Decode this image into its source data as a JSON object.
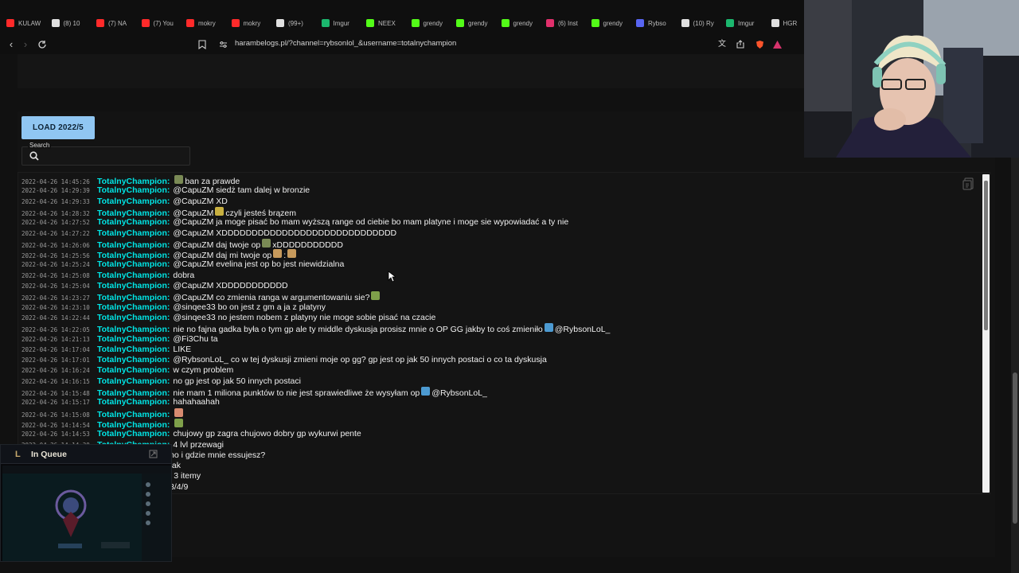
{
  "browser": {
    "tabs": [
      {
        "label": "KULAW",
        "icon": "youtube-icon",
        "color": "#ff2a2a"
      },
      {
        "label": "(8) 10",
        "icon": "x-icon",
        "color": "#e0e0e0"
      },
      {
        "label": "(7) NA",
        "icon": "youtube-icon",
        "color": "#ff2a2a"
      },
      {
        "label": "(7) You",
        "icon": "youtube-icon",
        "color": "#ff2a2a"
      },
      {
        "label": "mokry",
        "icon": "youtube-icon",
        "color": "#ff2a2a"
      },
      {
        "label": "mokry",
        "icon": "youtube-icon",
        "color": "#ff2a2a"
      },
      {
        "label": "(99+)",
        "icon": "tiktok-icon",
        "color": "#e0e0e0"
      },
      {
        "label": "Imgur",
        "icon": "imgur-icon",
        "color": "#1bb76e"
      },
      {
        "label": "NEEX",
        "icon": "kick-icon",
        "color": "#53fc18"
      },
      {
        "label": "grendy",
        "icon": "kick-icon",
        "color": "#53fc18"
      },
      {
        "label": "grendy",
        "icon": "kick-icon",
        "color": "#53fc18"
      },
      {
        "label": "grendy",
        "icon": "kick-icon",
        "color": "#53fc18"
      },
      {
        "label": "(6) Inst",
        "icon": "instagram-icon",
        "color": "#e1306c"
      },
      {
        "label": "grendy",
        "icon": "kick-icon",
        "color": "#53fc18"
      },
      {
        "label": "Rybso",
        "icon": "discord-icon",
        "color": "#5865f2"
      },
      {
        "label": "(10) Ry",
        "icon": "x-icon",
        "color": "#e0e0e0"
      },
      {
        "label": "Imgur",
        "icon": "imgur-icon",
        "color": "#1bb76e"
      },
      {
        "label": "HGR",
        "icon": "x-icon",
        "color": "#e0e0e0"
      }
    ],
    "url": "harambelogs.pl/?channel=rybsonlol_&username=totalnychampion"
  },
  "page": {
    "load_button": "LOAD 2022/5",
    "search_label": "Search",
    "search_value": ""
  },
  "log": [
    {
      "ts": "2022-04-26 14:45:26",
      "user": "TotalnyChampion:",
      "msg": "ban za prawde",
      "emote_before": true
    },
    {
      "ts": "2022-04-26 14:29:39",
      "user": "TotalnyChampion:",
      "msg": "@CapuZM siedż tam dalej w bronzie"
    },
    {
      "ts": "2022-04-26 14:29:33",
      "user": "TotalnyChampion:",
      "msg": "@CapuZM XD"
    },
    {
      "ts": "2022-04-26 14:28:32",
      "user": "TotalnyChampion:",
      "msg": "@CapuZM",
      "msg_after": "czyli jesteś brązem",
      "emote_mid": true
    },
    {
      "ts": "2022-04-26 14:27:52",
      "user": "TotalnyChampion:",
      "msg": "@CapuZM ja moge pisać bo mam wyższą range od ciebie bo mam platyne i moge sie wypowiadać a ty nie"
    },
    {
      "ts": "2022-04-26 14:27:22",
      "user": "TotalnyChampion:",
      "msg": "@CapuZM XDDDDDDDDDDDDDDDDDDDDDDDDDDDDD"
    },
    {
      "ts": "2022-04-26 14:26:06",
      "user": "TotalnyChampion:",
      "msg": "@CapuZM daj twoje op",
      "msg_after": "xDDDDDDDDDDD",
      "emote_mid": true
    },
    {
      "ts": "2022-04-26 14:25:56",
      "user": "TotalnyChampion:",
      "msg": "@CapuZM daj mi twoje op",
      "msg_after": ":",
      "emote_mid": true,
      "emote_end": true
    },
    {
      "ts": "2022-04-26 14:25:24",
      "user": "TotalnyChampion:",
      "msg": "@CapuZM evelina jest op bo jest niewidzialna"
    },
    {
      "ts": "2022-04-26 14:25:08",
      "user": "TotalnyChampion:",
      "msg": "dobra"
    },
    {
      "ts": "2022-04-26 14:25:04",
      "user": "TotalnyChampion:",
      "msg": "@CapuZM XDDDDDDDDDDD"
    },
    {
      "ts": "2022-04-26 14:23:27",
      "user": "TotalnyChampion:",
      "msg": "@CapuZM co zmienia ranga w argumentowaniu sie?",
      "emote_end": true
    },
    {
      "ts": "2022-04-26 14:23:10",
      "user": "TotalnyChampion:",
      "msg": "@sinqee33 bo on jest z gm a ja z platyny"
    },
    {
      "ts": "2022-04-26 14:22:44",
      "user": "TotalnyChampion:",
      "msg": "@sinqee33 no jestem nobem z platyny nie moge sobie pisać na czacie"
    },
    {
      "ts": "2022-04-26 14:22:05",
      "user": "TotalnyChampion:",
      "msg": "nie no fajna gadka była o tym gp ale ty middle dyskusja prosisz mnie o OP GG jakby to coś zmieniło",
      "msg_after": "@RybsonLoL_",
      "emote_mid": true
    },
    {
      "ts": "2022-04-26 14:21:13",
      "user": "TotalnyChampion:",
      "msg": "@Fi3Chu ta"
    },
    {
      "ts": "2022-04-26 14:17:04",
      "user": "TotalnyChampion:",
      "msg": "LIKE"
    },
    {
      "ts": "2022-04-26 14:17:01",
      "user": "TotalnyChampion:",
      "msg": "@RybsonLoL_ co w tej dyskusji zmieni moje op gg? gp jest op jak 50 innych postaci o co ta dyskusja"
    },
    {
      "ts": "2022-04-26 14:16:24",
      "user": "TotalnyChampion:",
      "msg": "w czym problem"
    },
    {
      "ts": "2022-04-26 14:16:15",
      "user": "TotalnyChampion:",
      "msg": "no gp jest op jak 50 innych postaci"
    },
    {
      "ts": "2022-04-26 14:15:48",
      "user": "TotalnyChampion:",
      "msg": "nie mam 1 miliona punktów to nie jest sprawiedliwe że wysyłam op",
      "msg_after": "@RybsonLoL_",
      "emote_mid": true
    },
    {
      "ts": "2022-04-26 14:15:17",
      "user": "TotalnyChampion:",
      "msg": "hahahaahah"
    },
    {
      "ts": "2022-04-26 14:15:08",
      "user": "TotalnyChampion:",
      "msg": "",
      "emote_end": true
    },
    {
      "ts": "2022-04-26 14:14:54",
      "user": "TotalnyChampion:",
      "msg": "",
      "emote_end": true
    },
    {
      "ts": "2022-04-26 14:14:53",
      "user": "TotalnyChampion:",
      "msg": "chujowy gp zagra chujowo dobry gp wykurwi pente"
    },
    {
      "ts": "2022-04-26 14:14:30",
      "user": "TotalnyChampion:",
      "msg": "4 lvl przewagi"
    },
    {
      "ts": "",
      "user": "",
      "msg": "no i gdzie mnie essujesz?"
    },
    {
      "ts": "",
      "user": "",
      "msg": "tak"
    },
    {
      "ts": "",
      "user": "",
      "msg": "i 3 itemy"
    },
    {
      "ts": "",
      "user": "",
      "msg": "3/4/9"
    }
  ],
  "overlay": {
    "title": "In Queue",
    "logo": "L"
  },
  "colors": {
    "accent": "#90c6f2",
    "username": "#00e5e5"
  }
}
